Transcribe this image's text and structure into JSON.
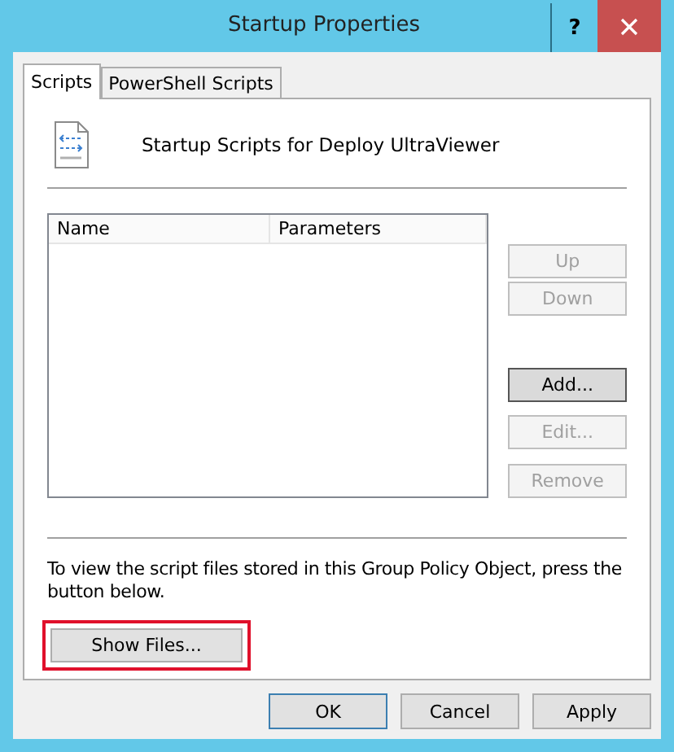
{
  "window": {
    "title": "Startup Properties",
    "help": "?"
  },
  "tabs": [
    {
      "label": "Scripts",
      "selected": true
    },
    {
      "label": "PowerShell Scripts",
      "selected": false
    }
  ],
  "heading": "Startup Scripts for Deploy UltraViewer",
  "table": {
    "columns": [
      "Name",
      "Parameters"
    ]
  },
  "side_buttons": [
    {
      "label": "Up",
      "disabled": true,
      "focused": false
    },
    {
      "label": "Down",
      "disabled": true,
      "focused": false
    },
    {
      "label": "Add...",
      "disabled": false,
      "focused": true
    },
    {
      "label": "Edit...",
      "disabled": true,
      "focused": false
    },
    {
      "label": "Remove",
      "disabled": true,
      "focused": false
    }
  ],
  "info_text": "To view the script files stored in this Group Policy Object, press the button below.",
  "show_files_button": {
    "label": "Show Files...",
    "highlighted": true
  },
  "footer_buttons": [
    {
      "label": "OK",
      "default": true
    },
    {
      "label": "Cancel",
      "default": false
    },
    {
      "label": "Apply",
      "default": false
    }
  ]
}
